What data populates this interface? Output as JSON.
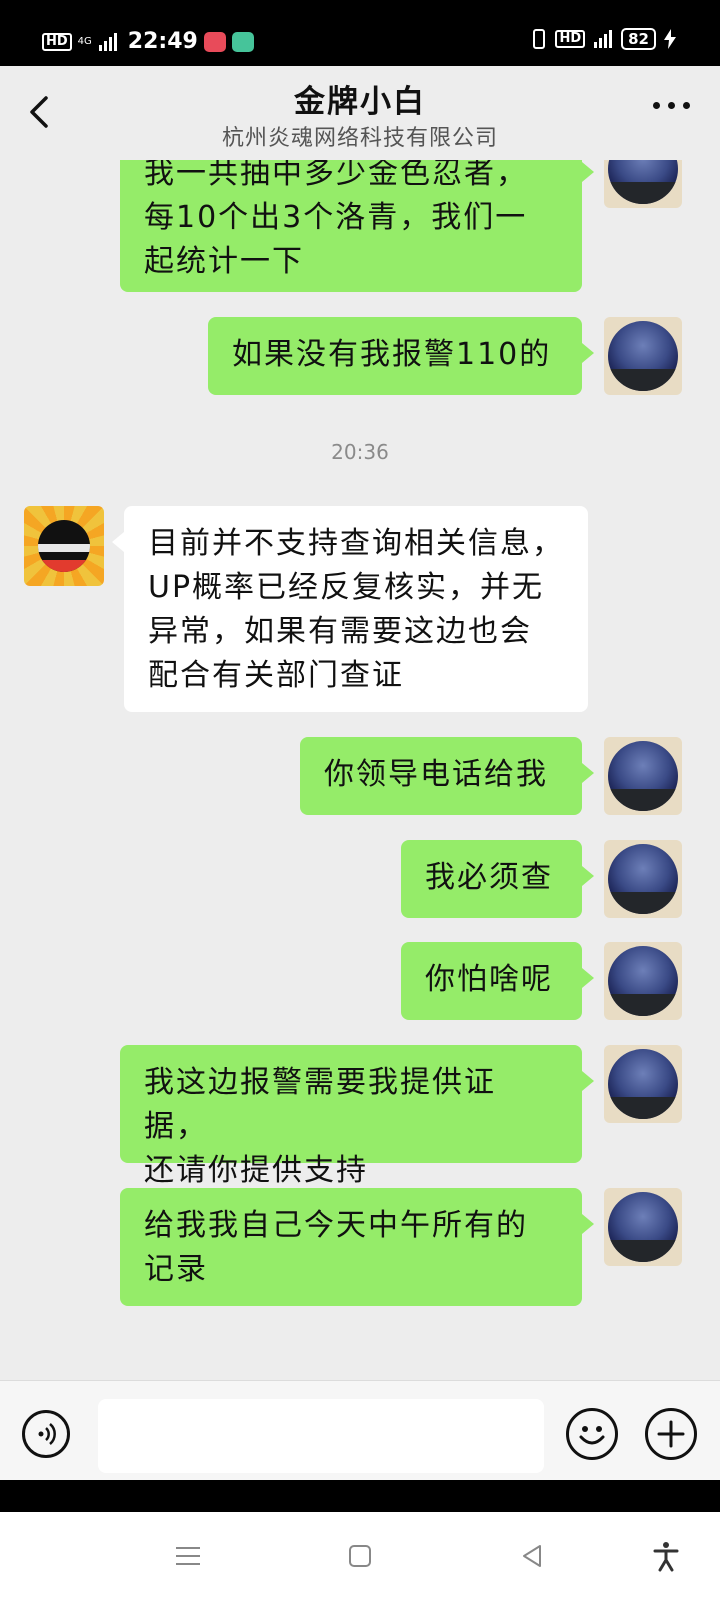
{
  "status_bar": {
    "hd_label": "HD",
    "network_label": "4G",
    "time": "22:49",
    "hd2_label": "HD",
    "battery": "82"
  },
  "header": {
    "title": "金牌小白",
    "subtitle": "杭州炎魂网络科技有限公司"
  },
  "messages": [
    {
      "from": "me",
      "text": "我一共抽中多少金色忍者，\n每10个出3个洛青，我们一\n起统计一下"
    },
    {
      "from": "me",
      "text": "如果没有我报警110的"
    },
    {
      "type": "time",
      "text": "20:36"
    },
    {
      "from": "them",
      "text": "目前并不支持查询相关信息，\nUP概率已经反复核实，并无\n异常，如果有需要这边也会\n配合有关部门查证"
    },
    {
      "from": "me",
      "text": "你领导电话给我"
    },
    {
      "from": "me",
      "text": "我必须查"
    },
    {
      "from": "me",
      "text": "你怕啥呢"
    },
    {
      "from": "me",
      "text": "我这边报警需要我提供证据，\n还请你提供支持"
    },
    {
      "from": "me",
      "text": "给我我自己今天中午所有的\n记录"
    }
  ],
  "input_bar": {
    "input_value": "",
    "voice_icon": "voice-icon",
    "emoji_icon": "emoji-icon",
    "plus_icon": "plus-icon"
  },
  "colors": {
    "my_bubble": "#95ec69",
    "their_bubble": "#ffffff",
    "background": "#ededed"
  }
}
